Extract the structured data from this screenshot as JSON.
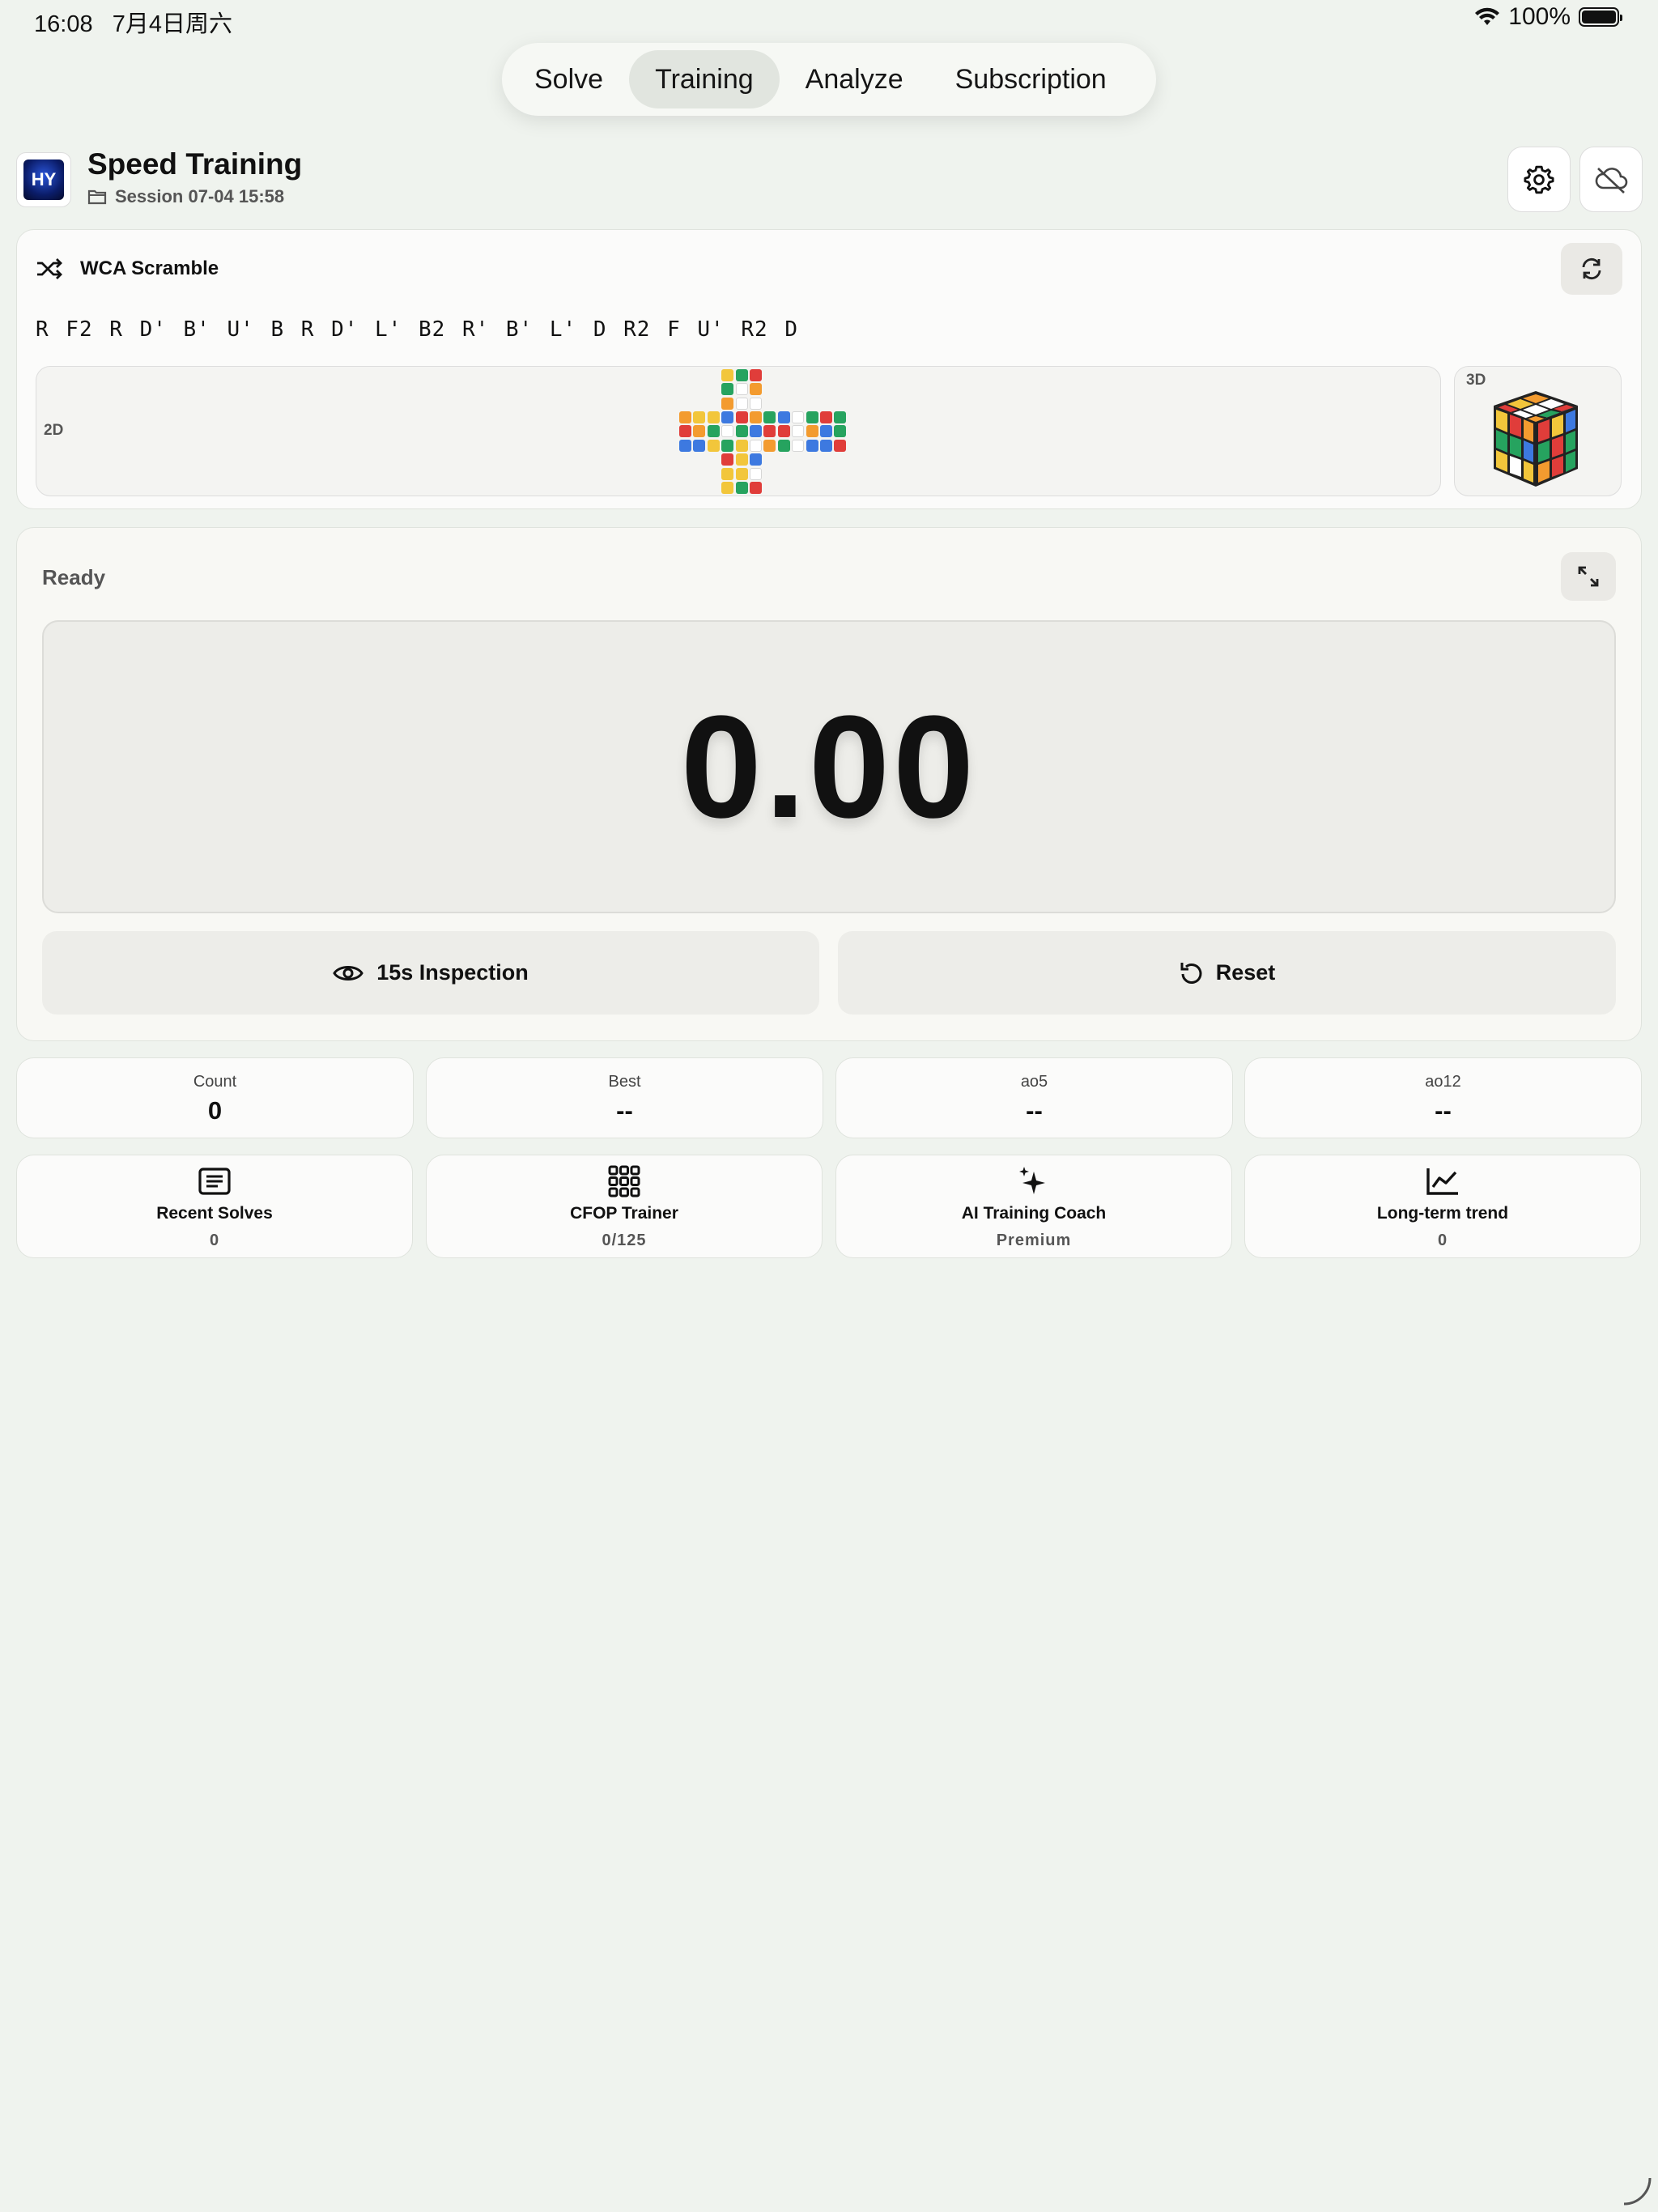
{
  "status_bar": {
    "time": "16:08",
    "date": "7月4日周六",
    "battery": "100%"
  },
  "nav": {
    "tabs": [
      "Solve",
      "Training",
      "Analyze",
      "Subscription"
    ],
    "active": "Training"
  },
  "header": {
    "title": "Speed Training",
    "session": "Session 07-04 15:58",
    "app_icon_text": "HY"
  },
  "scramble": {
    "title": "WCA Scramble",
    "moves": "R F2 R D' B' U' B R D' L' B2 R' B' L' D R2 F U' R2 D",
    "label_2d": "2D",
    "label_3d": "3D"
  },
  "net_colors": {
    "U": [
      "#f2c63b",
      "#26a35f",
      "#e03d3a",
      "#26a35f",
      "#ffffff",
      "#f39b2f",
      "#f39b2f",
      "#ffffff",
      "#ffffff"
    ],
    "L": [
      "#f39b2f",
      "#f2c63b",
      "#f2c63b",
      "#e03d3a",
      "#f39b2f",
      "#26a35f",
      "#3d79e0",
      "#3d79e0",
      "#f2c63b"
    ],
    "F": [
      "#3d79e0",
      "#e03d3a",
      "#f39b2f",
      "#ffffff",
      "#26a35f",
      "#3d79e0",
      "#26a35f",
      "#f2c63b",
      "#ffffff"
    ],
    "R": [
      "#26a35f",
      "#3d79e0",
      "#ffffff",
      "#e03d3a",
      "#e03d3a",
      "#ffffff",
      "#f39b2f",
      "#26a35f",
      "#ffffff"
    ],
    "B": [
      "#26a35f",
      "#e03d3a",
      "#26a35f",
      "#f39b2f",
      "#3d79e0",
      "#26a35f",
      "#3d79e0",
      "#3d79e0",
      "#e03d3a"
    ],
    "D": [
      "#e03d3a",
      "#f2c63b",
      "#3d79e0",
      "#f2c63b",
      "#f2c63b",
      "#ffffff",
      "#f2c63b",
      "#26a35f",
      "#e03d3a"
    ]
  },
  "timer": {
    "state": "Ready",
    "value": "0.00"
  },
  "actions": {
    "inspection": "15s Inspection",
    "reset": "Reset"
  },
  "stats": [
    {
      "label": "Count",
      "value": "0"
    },
    {
      "label": "Best",
      "value": "--"
    },
    {
      "label": "ao5",
      "value": "--"
    },
    {
      "label": "ao12",
      "value": "--"
    }
  ],
  "tools": [
    {
      "title": "Recent Solves",
      "sub": "0",
      "icon": "list-icon"
    },
    {
      "title": "CFOP Trainer",
      "sub": "0/125",
      "icon": "grid-icon"
    },
    {
      "title": "AI Training Coach",
      "sub": "Premium",
      "icon": "sparkle-icon"
    },
    {
      "title": "Long-term trend",
      "sub": "0",
      "icon": "trend-icon"
    }
  ]
}
